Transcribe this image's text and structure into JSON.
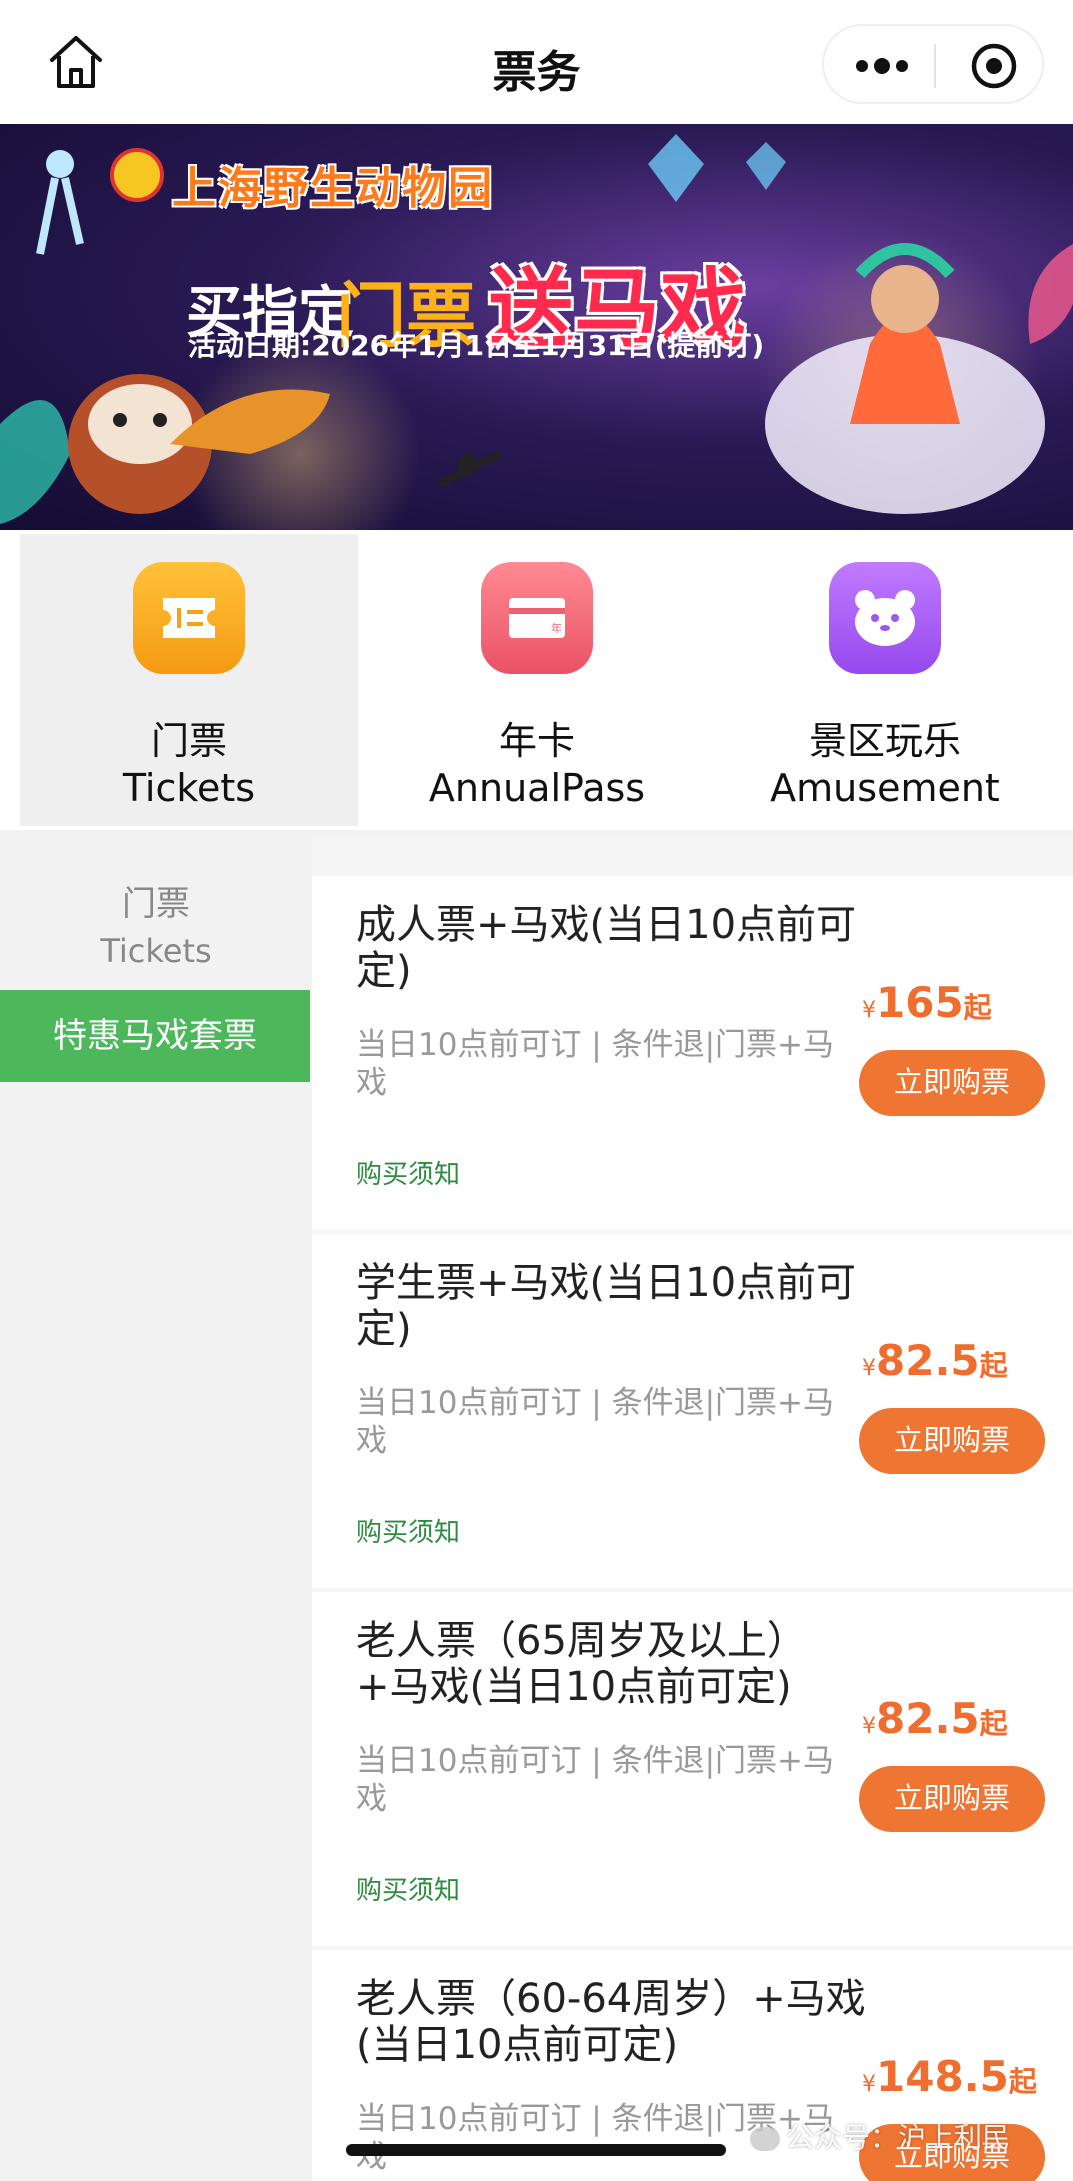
{
  "nav": {
    "title": "票务",
    "home_icon": "home-icon",
    "more_icon": "more-dots-icon",
    "close_icon": "target-circle-icon"
  },
  "banner": {
    "logo_text": "上海野生动物园",
    "headline_prefix": "买指定",
    "headline_tickets": "门票",
    "headline_gift": "送马戏",
    "date_text": "活动日期:2026年1月1日至1月31日(提前订)"
  },
  "categories": [
    {
      "zh": "门票",
      "en": "Tickets",
      "icon": "ticket-icon",
      "color": "#f7a41c",
      "active": true
    },
    {
      "zh": "年卡",
      "en": "AnnualPass",
      "icon": "annual-card-icon",
      "color": "#ef5f6f",
      "active": false
    },
    {
      "zh": "景区玩乐",
      "en": "Amusement",
      "icon": "bear-icon",
      "color": "#a35ff0",
      "active": false
    }
  ],
  "sidebar": {
    "section_zh": "门票",
    "section_en": "Tickets",
    "active_item": "特惠马戏套票"
  },
  "products": [
    {
      "title": "成人票+马戏(当日10点前可定)",
      "desc": "当日10点前可订 | 条件退|门票+马戏",
      "notice": "购买须知",
      "yen": "¥",
      "price": "165",
      "suffix": "起",
      "button": "立即购票"
    },
    {
      "title": "学生票+马戏(当日10点前可定)",
      "desc": "当日10点前可订 | 条件退|门票+马戏",
      "notice": "购买须知",
      "yen": "¥",
      "price": "82.5",
      "suffix": "起",
      "button": "立即购票"
    },
    {
      "title": "老人票（65周岁及以上）+马戏(当日10点前可定)",
      "desc": "当日10点前可订 | 条件退|门票+马戏",
      "notice": "购买须知",
      "yen": "¥",
      "price": "82.5",
      "suffix": "起",
      "button": "立即购票"
    },
    {
      "title": "老人票（60-64周岁）+马戏(当日10点前可定)",
      "desc": "当日10点前可订 | 条件退|门票+马戏",
      "notice": "",
      "yen": "¥",
      "price": "148.5",
      "suffix": "起",
      "button": "立即购票"
    }
  ],
  "watermark": "公众号：沪上利民",
  "colors": {
    "accent_orange": "#ef7533",
    "price_orange": "#ef6d2f",
    "sidebar_active_green": "#4cb85b",
    "notice_green": "#2e8b3f"
  }
}
